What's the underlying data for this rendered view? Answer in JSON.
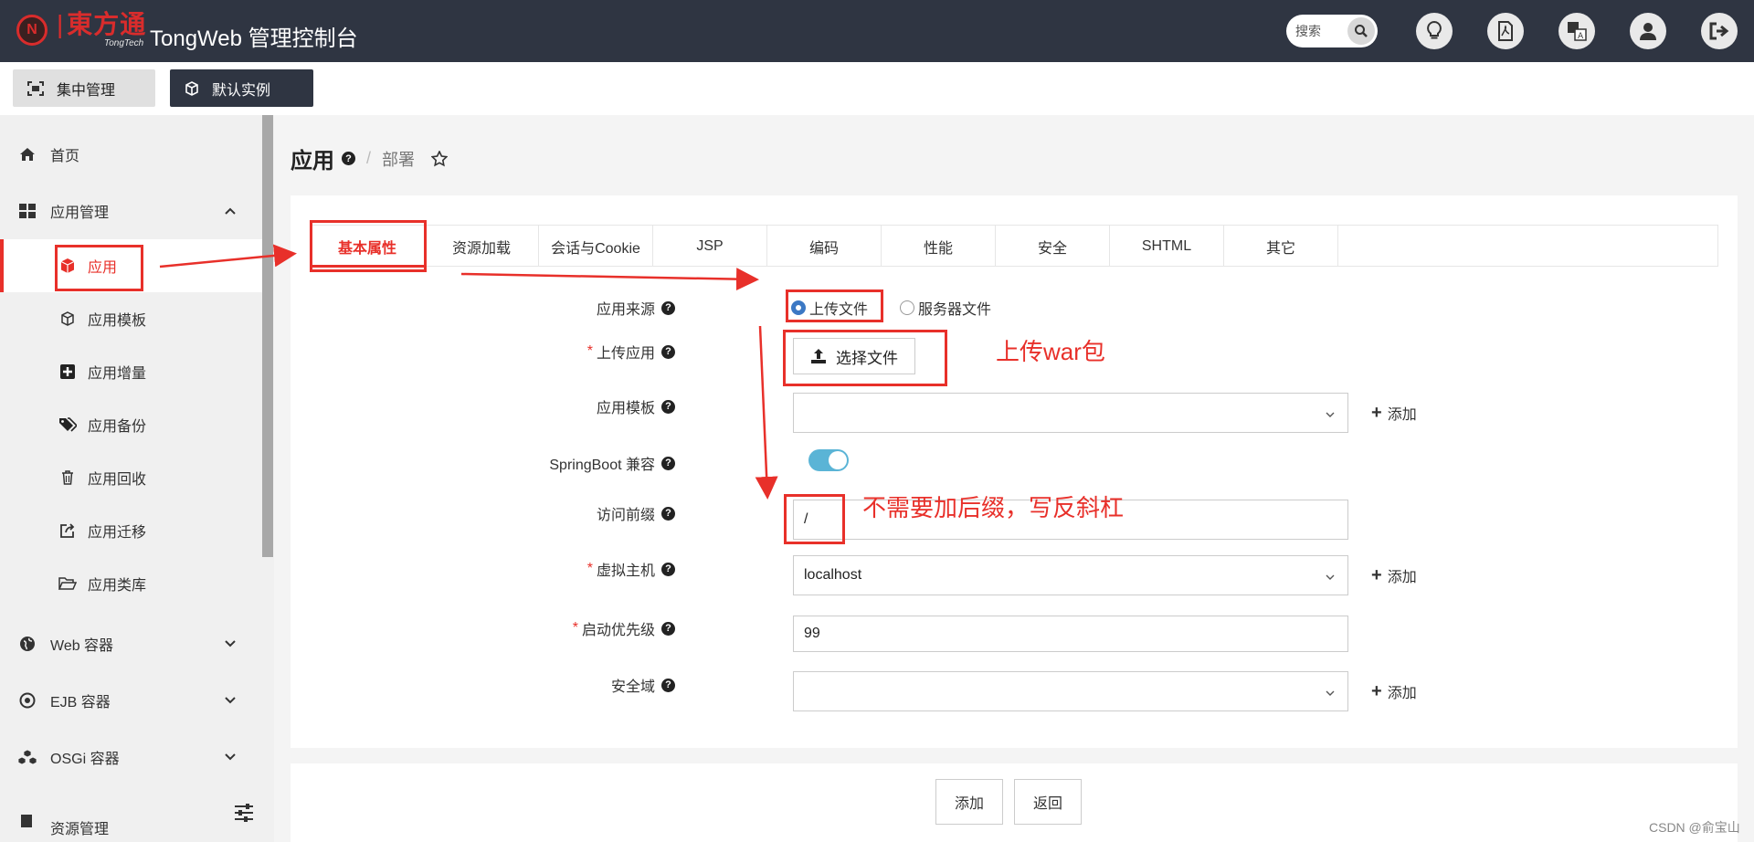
{
  "header": {
    "logo_cn": "東方通",
    "logo_en": "TongTech",
    "title": "TongWeb 管理控制台",
    "search_placeholder": "搜索",
    "icons": [
      "lightbulb-icon",
      "pdf-icon",
      "translate-icon",
      "user-icon",
      "logout-icon"
    ]
  },
  "subbar": {
    "central": "集中管理",
    "instance": "默认实例"
  },
  "sidebar": {
    "items": [
      {
        "label": "首页"
      },
      {
        "label": "应用管理"
      },
      {
        "label": "应用"
      },
      {
        "label": "应用模板"
      },
      {
        "label": "应用增量"
      },
      {
        "label": "应用备份"
      },
      {
        "label": "应用回收"
      },
      {
        "label": "应用迁移"
      },
      {
        "label": "应用类库"
      },
      {
        "label": "Web 容器"
      },
      {
        "label": "EJB 容器"
      },
      {
        "label": "OSGi 容器"
      },
      {
        "label": "资源管理"
      }
    ]
  },
  "breadcrumb": {
    "title": "应用",
    "current": "部署"
  },
  "tabs": [
    "基本属性",
    "资源加载",
    "会话与Cookie",
    "JSP",
    "编码",
    "性能",
    "安全",
    "SHTML",
    "其它"
  ],
  "form": {
    "source_label": "应用来源",
    "source_upload": "上传文件",
    "source_server": "服务器文件",
    "upload_label": "上传应用",
    "choose_file": "选择文件",
    "template_label": "应用模板",
    "template_value": "",
    "springboot_label": "SpringBoot 兼容",
    "prefix_label": "访问前缀",
    "prefix_value": "/",
    "vhost_label": "虚拟主机",
    "vhost_value": "localhost",
    "priority_label": "启动优先级",
    "priority_value": "99",
    "realm_label": "安全域",
    "realm_value": "",
    "add": "添加"
  },
  "footer": {
    "add": "添加",
    "back": "返回"
  },
  "annotations": {
    "upload_war": "上传war包",
    "no_suffix": "不需要加后缀，写反斜杠"
  },
  "watermark": "CSDN @俞宝山",
  "colors": {
    "accent": "#e8302a",
    "header_bg": "#2f3542",
    "toggle_on": "#5ab4d6"
  }
}
